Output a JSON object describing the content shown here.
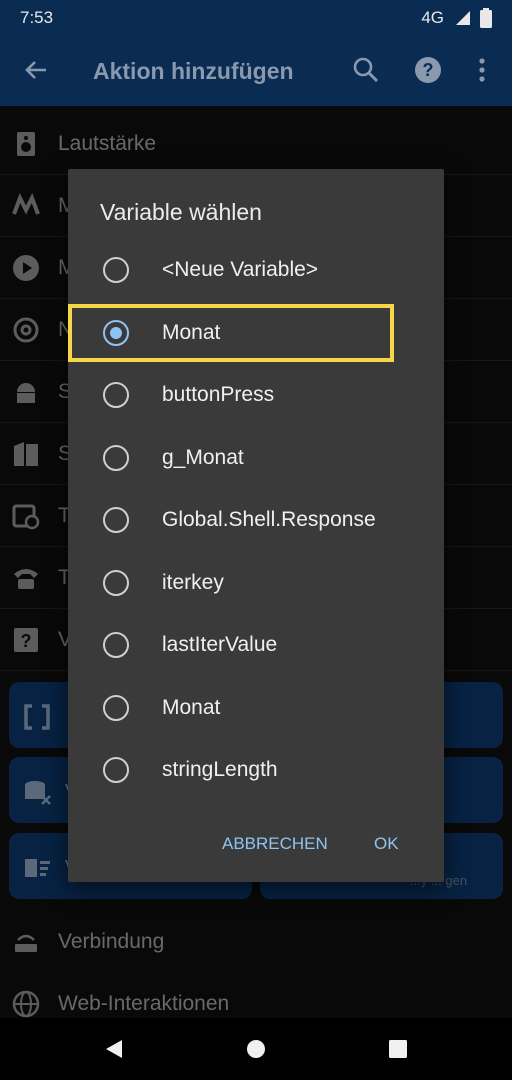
{
  "status": {
    "time": "7:53",
    "network": "4G"
  },
  "appbar": {
    "title": "Aktion hinzufügen"
  },
  "list": {
    "items": [
      {
        "label": "Lautstärke",
        "icon": "speaker-icon"
      },
      {
        "label": "M",
        "icon": "media-icon"
      },
      {
        "label": "M",
        "icon": "play-icon"
      },
      {
        "label": "N",
        "icon": "at-icon"
      },
      {
        "label": "S",
        "icon": "android-icon"
      },
      {
        "label": "S",
        "icon": "map-icon"
      },
      {
        "label": "T",
        "icon": "calendar-icon"
      },
      {
        "label": "T",
        "icon": "phone-icon"
      },
      {
        "label": "V",
        "icon": "question-icon"
      }
    ],
    "tiles": [
      {
        "label": "",
        "icon": "brackets-icon"
      },
      {
        "label": "V",
        "icon": "database-clear-icon"
      },
      {
        "label": "V",
        "icon": "list-delete-icon"
      },
      {
        "label": "...y ... gen",
        "icon": ""
      }
    ],
    "bottom_items": [
      {
        "label": "Verbindung",
        "icon": "router-icon"
      },
      {
        "label": "Web-Interaktionen",
        "icon": "globe-icon"
      }
    ]
  },
  "dialog": {
    "title": "Variable wählen",
    "options": [
      {
        "label": "<Neue Variable>",
        "selected": false
      },
      {
        "label": "Monat",
        "selected": true
      },
      {
        "label": "buttonPress",
        "selected": false
      },
      {
        "label": "g_Monat",
        "selected": false
      },
      {
        "label": "Global.Shell.Response",
        "selected": false
      },
      {
        "label": "iterkey",
        "selected": false
      },
      {
        "label": "lastIterValue",
        "selected": false
      },
      {
        "label": "Monat",
        "selected": false
      },
      {
        "label": "stringLength",
        "selected": false
      }
    ],
    "cancel_label": "ABBRECHEN",
    "ok_label": "OK"
  },
  "colors": {
    "accent": "#8fc3f2",
    "highlight": "#f4d84a",
    "appbar": "#0a2b52",
    "tile": "#0d3f7a"
  }
}
